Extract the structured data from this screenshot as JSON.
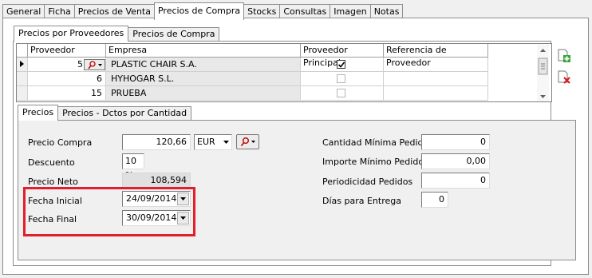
{
  "main_tabs": [
    "General",
    "Ficha",
    "Precios de Venta",
    "Precios de Compra",
    "Stocks",
    "Consultas",
    "Imagen",
    "Notas"
  ],
  "sub_tabs": [
    "Precios por Proveedores",
    "Precios de Compra"
  ],
  "grid": {
    "columns": [
      "Proveedor",
      "Empresa",
      "Proveedor Principal",
      "Referencia de Proveedor"
    ],
    "rows": [
      {
        "proveedor": "5",
        "empresa": "PLASTIC CHAIR S.A.",
        "principal": true,
        "referencia": ""
      },
      {
        "proveedor": "6",
        "empresa": "HYHOGAR S.L.",
        "principal": false,
        "referencia": ""
      },
      {
        "proveedor": "15",
        "empresa": "PRUEBA",
        "principal": false,
        "referencia": ""
      }
    ]
  },
  "detail_tabs": [
    "Precios",
    "Precios - Dctos por Cantidad"
  ],
  "form": {
    "precio_compra_label": "Precio Compra",
    "precio_compra_value": "120,66",
    "currency": "EUR",
    "descuento_label": "Descuento",
    "descuento_value": "10 %",
    "precio_neto_label": "Precio Neto",
    "precio_neto_value": "108,594",
    "fecha_inicial_label": "Fecha Inicial",
    "fecha_inicial_value": "24/09/2014",
    "fecha_final_label": "Fecha Final",
    "fecha_final_value": "30/09/2014",
    "cantidad_minima_label": "Cantidad Mínima Pedido",
    "cantidad_minima_value": "0",
    "importe_minimo_label": "Importe Mínimo Pedido",
    "importe_minimo_value": "0,00",
    "periodicidad_label": "Periodicidad Pedidos",
    "periodicidad_value": "0",
    "dias_entrega_label": "Días para Entrega",
    "dias_entrega_value": "0"
  },
  "colors": {
    "highlight": "#e0202a",
    "add": "#3aa33a",
    "delete": "#d02020"
  },
  "icons": [
    "search-icon",
    "dropdown-arrow-icon",
    "row-pointer-icon",
    "add-document-icon",
    "delete-document-icon"
  ]
}
